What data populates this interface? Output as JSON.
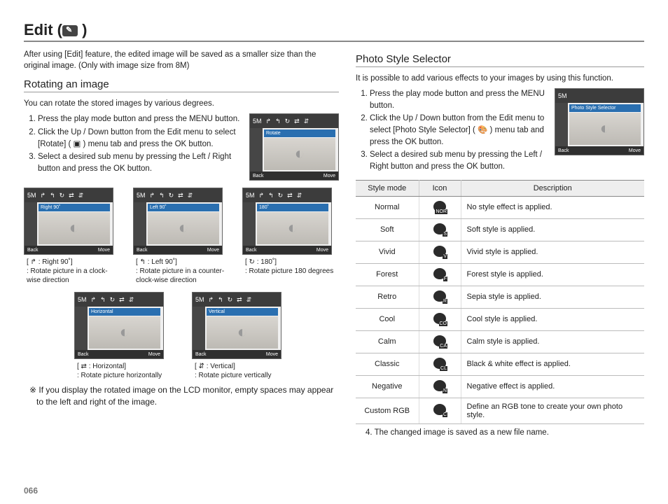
{
  "page_number": "066",
  "title_prefix": "Edit (",
  "title_suffix": " )",
  "intro": "After using [Edit] feature, the edited image will be saved as a smaller size than the original image. (Only with image size from 8M)",
  "left": {
    "heading": "Rotating an image",
    "lead": "You can rotate the stored images by various degrees.",
    "steps": [
      "Press the play mode button and press the MENU button.",
      "Click the Up / Down button from the Edit menu to select [Rotate] ( ▣ ) menu tab and press the OK button.",
      "Select a desired sub menu by pressing the Left / Right button and press the OK button."
    ],
    "main_lcd": {
      "indicator": "5M",
      "mode": "Rotate",
      "back": "Back",
      "move": "Move"
    },
    "thumbs_row1": [
      {
        "mode": "Right 90˚",
        "cap_lead": "[ ↱ : Right 90˚]",
        "cap_desc": ": Rotate picture in a clock-wise direction"
      },
      {
        "mode": "Left 90˚",
        "cap_lead": "[ ↰ : Left 90˚]",
        "cap_desc": ": Rotate picture in a counter-clock-wise direction"
      },
      {
        "mode": "180˚",
        "cap_lead": "[ ↻ : 180˚]",
        "cap_desc": ": Rotate picture 180 degrees"
      }
    ],
    "thumbs_row2": [
      {
        "mode": "Horizontal",
        "cap_lead": "[ ⇄ : Horizontal]",
        "cap_desc": ": Rotate picture horizontally"
      },
      {
        "mode": "Vertical",
        "cap_lead": "[ ⇵ : Vertical]",
        "cap_desc": ": Rotate picture vertically"
      }
    ],
    "note": "※ If you display the rotated image on the LCD monitor, empty spaces may appear to the left and right of the image."
  },
  "right": {
    "heading": "Photo Style Selector",
    "lead": "It is possible to add various effects to your images by using this function.",
    "steps": [
      "Press the play mode button and press the MENU button.",
      "Click the Up / Down button from the Edit menu to select [Photo Style Selector] ( 🎨 ) menu tab and press the OK button.",
      "Select a desired sub menu by pressing the Left / Right button and press the OK button."
    ],
    "main_lcd": {
      "indicator": "5M",
      "mode": "Photo Style Selector",
      "back": "Back",
      "move": "Move"
    },
    "table": {
      "headers": [
        "Style mode",
        "Icon",
        "Description"
      ],
      "rows": [
        {
          "mode": "Normal",
          "letter": "NOR",
          "desc": "No style effect is applied."
        },
        {
          "mode": "Soft",
          "letter": "S",
          "desc": "Soft style is applied."
        },
        {
          "mode": "Vivid",
          "letter": "V",
          "desc": "Vivid style is applied."
        },
        {
          "mode": "Forest",
          "letter": "F",
          "desc": "Forest style is applied."
        },
        {
          "mode": "Retro",
          "letter": "R",
          "desc": "Sepia style is applied."
        },
        {
          "mode": "Cool",
          "letter": "CO",
          "desc": "Cool style is applied."
        },
        {
          "mode": "Calm",
          "letter": "CA",
          "desc": "Calm style is applied."
        },
        {
          "mode": "Classic",
          "letter": "CL",
          "desc": "Black & white effect is applied."
        },
        {
          "mode": "Negative",
          "letter": "N",
          "desc": "Negative effect is applied."
        },
        {
          "mode": "Custom RGB",
          "letter": "C",
          "desc": "Define an RGB tone to create your own photo style."
        }
      ]
    },
    "footnote": "4. The changed image is saved as a new file name."
  }
}
